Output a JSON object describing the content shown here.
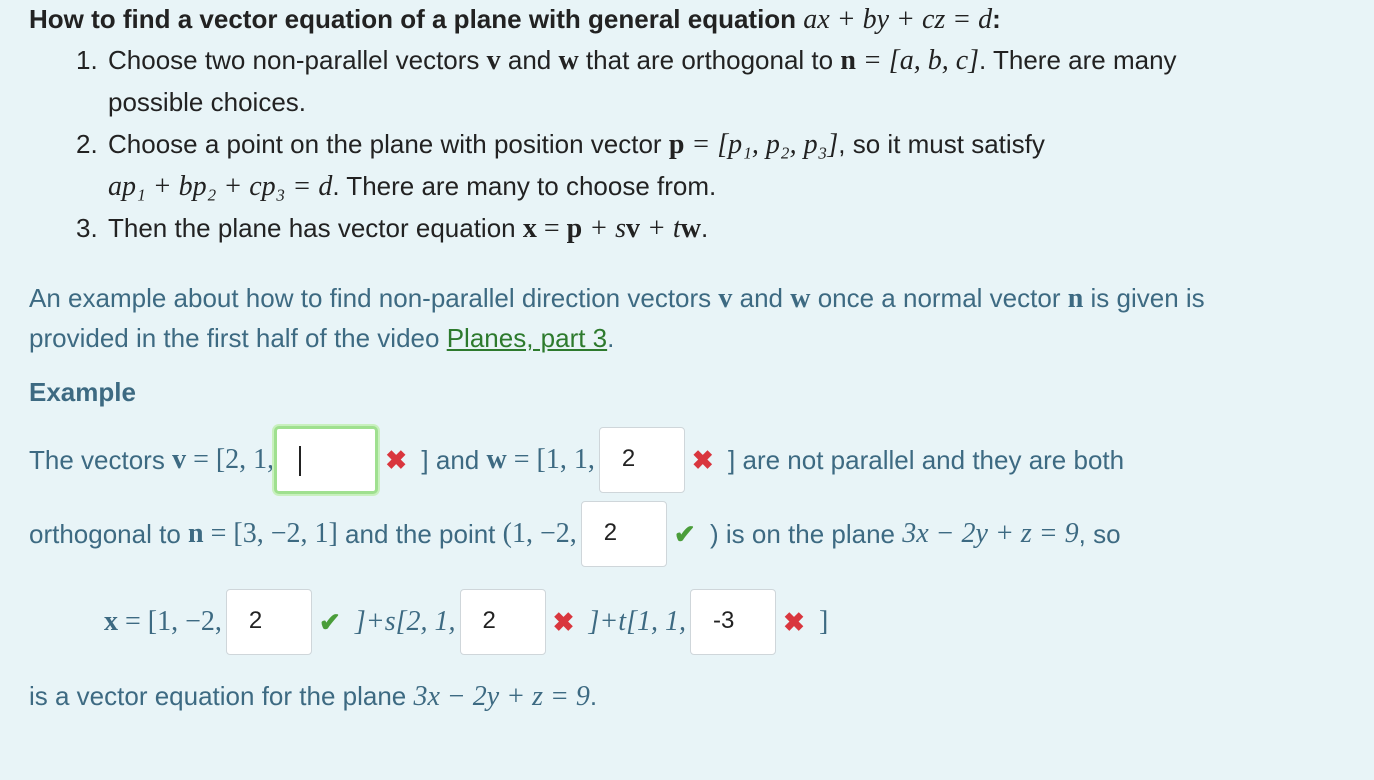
{
  "heading": {
    "text": "How to find a vector equation of a plane with general equation ",
    "math": "ax + by + cz = d",
    "suffix": ":"
  },
  "steps": [
    {
      "num": "1.",
      "text_a": "Choose two non-parallel vectors ",
      "v": "v",
      "and": " and ",
      "w": "w",
      "text_b": " that are orthogonal to ",
      "n": "n",
      "eq": " = [a, b, c]",
      "text_c": ". There are many",
      "cont": "possible choices."
    },
    {
      "num": "2.",
      "text_a": "Choose a point on the plane with position vector ",
      "p": "p",
      "eq": " = [p₁, p₂, p₃]",
      "text_b": ", so it must satisfy",
      "cont_math": "ap₁ + bp₂ + cp₃ = d",
      "cont_text": ". There are many to choose from."
    },
    {
      "num": "3.",
      "text_a": "Then the plane has vector equation ",
      "x": "x",
      "eq1": " = ",
      "p": "p",
      "eq2": " + s",
      "v": "v",
      "eq3": " + t",
      "w": "w",
      "text_b": "."
    }
  ],
  "example_para": {
    "text_a": "An example about how to find non-parallel direction vectors ",
    "v": "v",
    "and": " and ",
    "w": "w",
    "text_b": " once a normal vector  ",
    "n": "n",
    "text_c": " is given is",
    "line2": "provided in the first half of the video ",
    "link": "Planes, part 3",
    "end": "."
  },
  "example_heading": "Example",
  "row1": {
    "t1": "The vectors ",
    "v": "v",
    "m1": " = [2, 1,",
    "input1": "",
    "mark1": "✖",
    "t2": " ] and ",
    "w": "w",
    "m2": " = [1, 1,",
    "input2": "2",
    "mark2": "✖",
    "t3": " ] are not parallel and they are both"
  },
  "row2": {
    "t1": "orthogonal to ",
    "n": "n",
    "m1": " = [3, −2, 1]",
    "t2": " and the point ",
    "m2": "(1, −2,",
    "input": "2",
    "mark": "✔",
    "t3": " ) is on the plane ",
    "m3": "3x − 2y + z = 9",
    "t4": ", so"
  },
  "row3": {
    "x": "x",
    "m1": " = [1, −2,",
    "input1": "2",
    "mark1": "✔",
    "m2": " ]+s[2, 1,",
    "input2": "2",
    "mark2": "✖",
    "m3": " ]+t[1, 1,",
    "input3": "-3",
    "mark3": "✖",
    "m4": " ]"
  },
  "conclusion": {
    "text": "is a vector equation for the plane ",
    "math": "3x − 2y + z = 9",
    "end": "."
  },
  "colors": {
    "background": "#e8f4f7",
    "teal_text": "#3d6a82",
    "link": "#2d7a2d",
    "incorrect": "#d9363e",
    "correct": "#4a9d3a",
    "focus_border": "#9fe08f"
  }
}
